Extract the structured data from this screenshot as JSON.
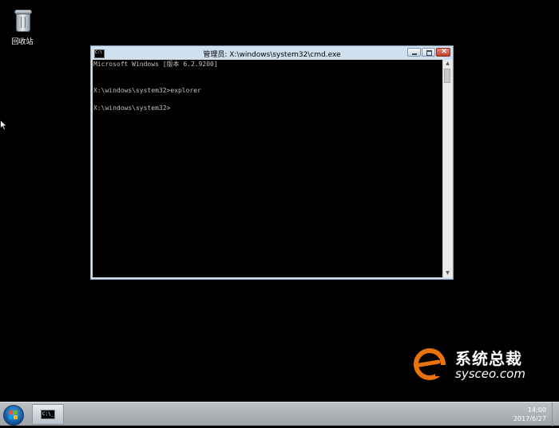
{
  "desktop": {
    "recycle_bin_label": "回收站"
  },
  "cmd_window": {
    "title": "管理员: X:\\windows\\system32\\cmd.exe",
    "title_icon_text": "C:\\",
    "lines": [
      "Microsoft Windows [版本 6.2.9200]",
      "",
      "",
      "X:\\windows\\system32>explorer",
      "",
      "X:\\windows\\system32>"
    ]
  },
  "taskbar": {
    "cmd_icon_text": "C:\\_",
    "clock_time": "14:00",
    "clock_date": "2017/6/27"
  },
  "watermark": {
    "name": "系统总裁",
    "url": "sysceo.com"
  },
  "colors": {
    "desktop_bg": "#000000",
    "console_text": "#c0c0c0",
    "watermark_orange": "#e8720c"
  }
}
